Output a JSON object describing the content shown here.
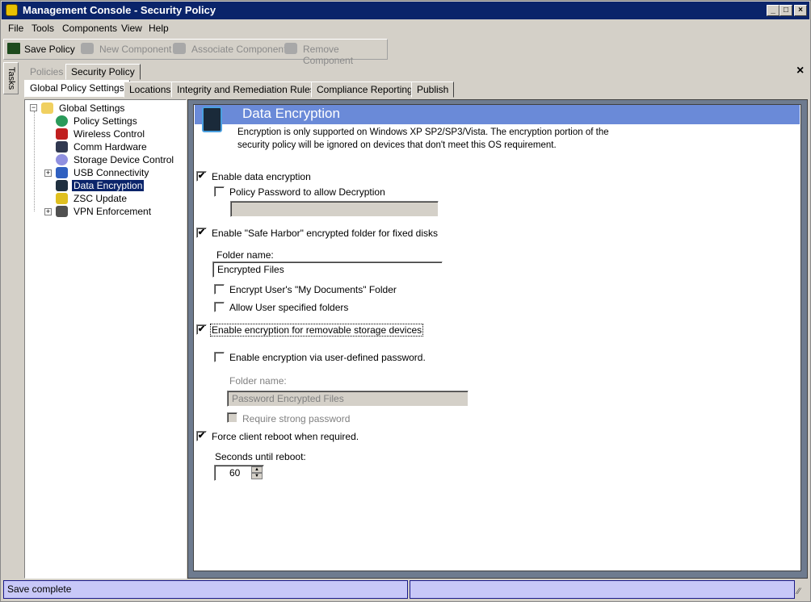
{
  "window": {
    "title": "Management Console - Security Policy",
    "minimize": "_",
    "maximize": "□",
    "close": "×"
  },
  "menu": [
    "File",
    "Tools",
    "Components",
    "View",
    "Help"
  ],
  "toolbar": {
    "save": "Save Policy",
    "new_component": "New Component",
    "associate_component": "Associate Component",
    "remove_component": "Remove Component"
  },
  "tasks_label": "Tasks",
  "doc_tabs": [
    "Policies",
    "Security Policy"
  ],
  "doc_close": "×",
  "policy_tabs": [
    "Global Policy Settings",
    "Locations",
    "Integrity and Remediation Rules",
    "Compliance Reporting",
    "Publish"
  ],
  "tree": {
    "root": "Global Settings",
    "items": [
      "Policy Settings",
      "Wireless Control",
      "Comm Hardware",
      "Storage Device Control",
      "USB Connectivity",
      "Data Encryption",
      "ZSC Update",
      "VPN Enforcement"
    ],
    "selected": "Data Encryption"
  },
  "panel": {
    "title": "Data Encryption",
    "description": [
      "Encryption is only supported on Windows XP SP2/SP3/Vista. The encryption portion of the",
      "security policy will be ignored on devices that don't meet this OS requirement."
    ],
    "enable_data_encryption": {
      "label": "Enable data encryption",
      "checked": true
    },
    "policy_password": {
      "label": "Policy Password to allow Decryption",
      "checked": false,
      "value": ""
    },
    "safe_harbor": {
      "label": "Enable \"Safe Harbor\" encrypted folder for fixed disks",
      "checked": true
    },
    "folder_name_label": "Folder name:",
    "folder_name_value": "Encrypted Files",
    "encrypt_my_documents": {
      "label": "Encrypt User's \"My Documents\" Folder",
      "checked": false
    },
    "allow_user_folders": {
      "label": "Allow User specified folders",
      "checked": false
    },
    "removable_storage": {
      "label": "Enable encryption for removable storage devices",
      "checked": true
    },
    "user_password": {
      "label": "Enable encryption via user-defined password.",
      "checked": false
    },
    "pw_folder_name_label": "Folder name:",
    "pw_folder_name_value": "Password Encrypted Files",
    "require_strong": {
      "label": "Require strong password",
      "checked": false
    },
    "force_reboot": {
      "label": "Force client reboot when required.",
      "checked": true
    },
    "seconds_label": "Seconds until reboot:",
    "seconds_value": "60",
    "check_mark": "✔"
  },
  "status": {
    "left": "Save complete",
    "right": ""
  }
}
